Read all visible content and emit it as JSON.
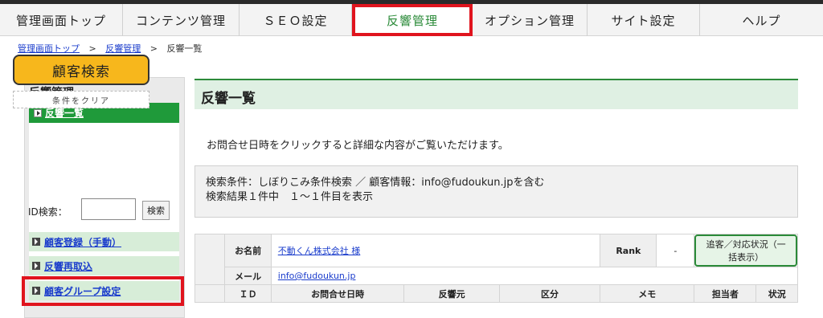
{
  "nav": {
    "items": [
      "管理画面トップ",
      "コンテンツ管理",
      "ＳＥＯ設定",
      "反響管理",
      "オプション管理",
      "サイト設定",
      "ヘルプ"
    ]
  },
  "breadcrumb": {
    "home": "管理画面トップ",
    "mid": "反響管理",
    "current": "反響一覧",
    "sep": ">"
  },
  "sidebar": {
    "heading": "反響管理",
    "active_item": "反響一覧",
    "search_button": "顧客検索",
    "clear_button": "条件をクリア",
    "id_label": "ID検索：",
    "id_button": "検索",
    "links": [
      "顧客登録（手動）",
      "反響再取込",
      "顧客グループ設定"
    ]
  },
  "main": {
    "title": "反響一覧",
    "intro": "お問合せ日時をクリックすると詳細な内容がご覧いただけます。",
    "cond_line1": "検索条件：しぼりこみ条件検索 ／ 顧客情報：info@fudoukun.jpを含む",
    "cond_line2": "検索結果１件中　１～１件目を表示"
  },
  "table": {
    "name_label": "お名前",
    "name_value": "不動くん株式会社 様",
    "rank_label": "Rank",
    "rank_value": "-",
    "follow_button": "追客／対応状況（一括表示）",
    "mail_label": "メール",
    "mail_value": "info@fudoukun.jp",
    "columns": [
      "ＩＤ",
      "お問合せ日時",
      "反響元",
      "区分",
      "メモ",
      "担当者",
      "状況"
    ]
  }
}
